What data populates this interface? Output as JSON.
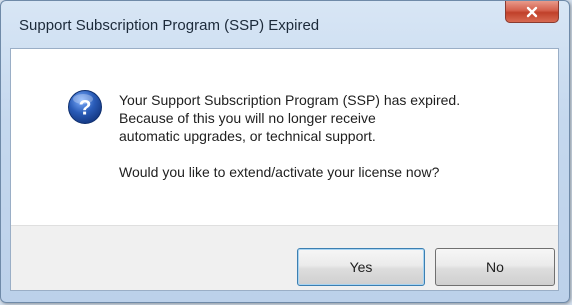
{
  "dialog": {
    "title": "Support Subscription Program (SSP) Expired",
    "close_icon": "close-icon",
    "icon": "question-icon",
    "message_lines": [
      "Your Support Subscription Program (SSP) has expired.",
      "Because of this you will no longer receive",
      "automatic upgrades, or technical support."
    ],
    "question": "Would you like to extend/activate your license now?",
    "buttons": {
      "yes_label": "Yes",
      "no_label": "No"
    }
  },
  "colors": {
    "title_frame": "#c5d8ee",
    "close_button": "#c7452f",
    "icon_blue": "#2a5cb8",
    "button_bar": "#f0f0f0"
  }
}
